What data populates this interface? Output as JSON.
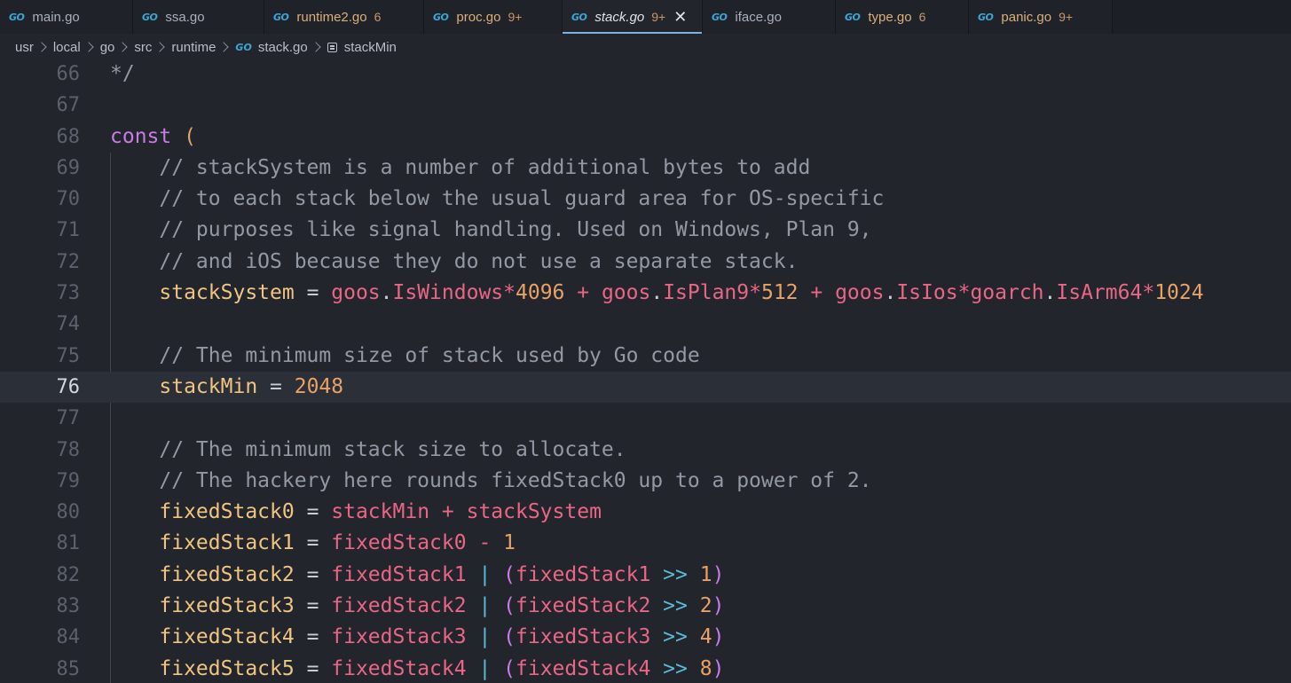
{
  "tabs": [
    {
      "label": "main.go",
      "badge": "",
      "modified": false,
      "active": false,
      "width": 150
    },
    {
      "label": "ssa.go",
      "badge": "",
      "modified": false,
      "active": false,
      "width": 148
    },
    {
      "label": "runtime2.go",
      "badge": "6",
      "modified": true,
      "active": false,
      "width": 180
    },
    {
      "label": "proc.go",
      "badge": "9+",
      "modified": true,
      "active": false,
      "width": 156
    },
    {
      "label": "stack.go",
      "badge": "9+",
      "modified": true,
      "active": true,
      "width": 158
    },
    {
      "label": "iface.go",
      "badge": "",
      "modified": false,
      "active": false,
      "width": 150
    },
    {
      "label": "type.go",
      "badge": "6",
      "modified": true,
      "active": false,
      "width": 150
    },
    {
      "label": "panic.go",
      "badge": "9+",
      "modified": true,
      "active": false,
      "width": 162
    }
  ],
  "tab_icon_text": "GO",
  "breadcrumb": [
    "usr",
    "local",
    "go",
    "src",
    "runtime",
    "stack.go",
    "stackMin"
  ],
  "current_line": 76,
  "code_lines": [
    {
      "n": 66,
      "t": [
        [
          "cmt",
          "*/"
        ]
      ]
    },
    {
      "n": 67,
      "t": []
    },
    {
      "n": 68,
      "t": [
        [
          "kw",
          "const"
        ],
        [
          "plain",
          " "
        ],
        [
          "paren",
          "("
        ]
      ]
    },
    {
      "n": 69,
      "t": [
        [
          "plain",
          "    "
        ],
        [
          "cmt",
          "// stackSystem is a number of additional bytes to add"
        ]
      ]
    },
    {
      "n": 70,
      "t": [
        [
          "plain",
          "    "
        ],
        [
          "cmt",
          "// to each stack below the usual guard area for OS-specific"
        ]
      ]
    },
    {
      "n": 71,
      "t": [
        [
          "plain",
          "    "
        ],
        [
          "cmt",
          "// purposes like signal handling. Used on Windows, Plan 9,"
        ]
      ]
    },
    {
      "n": 72,
      "t": [
        [
          "plain",
          "    "
        ],
        [
          "cmt",
          "// and iOS because they do not use a separate stack."
        ]
      ]
    },
    {
      "n": 73,
      "t": [
        [
          "plain",
          "    "
        ],
        [
          "const",
          "stackSystem"
        ],
        [
          "eq",
          " = "
        ],
        [
          "pkg",
          "goos"
        ],
        [
          "eq",
          "."
        ],
        [
          "pkg",
          "IsWindows"
        ],
        [
          "op",
          "*"
        ],
        [
          "num",
          "4096"
        ],
        [
          "op",
          " + "
        ],
        [
          "pkg",
          "goos"
        ],
        [
          "eq",
          "."
        ],
        [
          "pkg",
          "IsPlan9"
        ],
        [
          "op",
          "*"
        ],
        [
          "num",
          "512"
        ],
        [
          "op",
          " + "
        ],
        [
          "pkg",
          "goos"
        ],
        [
          "eq",
          "."
        ],
        [
          "pkg",
          "IsIos"
        ],
        [
          "op",
          "*"
        ],
        [
          "pkg",
          "goarch"
        ],
        [
          "eq",
          "."
        ],
        [
          "pkg",
          "IsArm64"
        ],
        [
          "op",
          "*"
        ],
        [
          "num",
          "1024"
        ]
      ]
    },
    {
      "n": 74,
      "t": []
    },
    {
      "n": 75,
      "t": [
        [
          "plain",
          "    "
        ],
        [
          "cmt",
          "// The minimum size of stack used by Go code"
        ]
      ]
    },
    {
      "n": 76,
      "t": [
        [
          "plain",
          "    "
        ],
        [
          "const",
          "stackMin"
        ],
        [
          "eq",
          " = "
        ],
        [
          "num",
          "2048"
        ]
      ]
    },
    {
      "n": 77,
      "t": []
    },
    {
      "n": 78,
      "t": [
        [
          "plain",
          "    "
        ],
        [
          "cmt",
          "// The minimum stack size to allocate."
        ]
      ]
    },
    {
      "n": 79,
      "t": [
        [
          "plain",
          "    "
        ],
        [
          "cmt",
          "// The hackery here rounds fixedStack0 up to a power of 2."
        ]
      ]
    },
    {
      "n": 80,
      "t": [
        [
          "plain",
          "    "
        ],
        [
          "const",
          "fixedStack0"
        ],
        [
          "eq",
          " = "
        ],
        [
          "pkg",
          "stackMin"
        ],
        [
          "op",
          " + "
        ],
        [
          "pkg",
          "stackSystem"
        ]
      ]
    },
    {
      "n": 81,
      "t": [
        [
          "plain",
          "    "
        ],
        [
          "const",
          "fixedStack1"
        ],
        [
          "eq",
          " = "
        ],
        [
          "pkg",
          "fixedStack0"
        ],
        [
          "op",
          " - "
        ],
        [
          "num",
          "1"
        ]
      ]
    },
    {
      "n": 82,
      "t": [
        [
          "plain",
          "    "
        ],
        [
          "const",
          "fixedStack2"
        ],
        [
          "eq",
          " = "
        ],
        [
          "pkg",
          "fixedStack1"
        ],
        [
          "pipe",
          " | "
        ],
        [
          "paren2",
          "("
        ],
        [
          "pkg",
          "fixedStack1"
        ],
        [
          "shift",
          " >> "
        ],
        [
          "num",
          "1"
        ],
        [
          "paren2",
          ")"
        ]
      ]
    },
    {
      "n": 83,
      "t": [
        [
          "plain",
          "    "
        ],
        [
          "const",
          "fixedStack3"
        ],
        [
          "eq",
          " = "
        ],
        [
          "pkg",
          "fixedStack2"
        ],
        [
          "pipe",
          " | "
        ],
        [
          "paren2",
          "("
        ],
        [
          "pkg",
          "fixedStack2"
        ],
        [
          "shift",
          " >> "
        ],
        [
          "num",
          "2"
        ],
        [
          "paren2",
          ")"
        ]
      ]
    },
    {
      "n": 84,
      "t": [
        [
          "plain",
          "    "
        ],
        [
          "const",
          "fixedStack4"
        ],
        [
          "eq",
          " = "
        ],
        [
          "pkg",
          "fixedStack3"
        ],
        [
          "pipe",
          " | "
        ],
        [
          "paren2",
          "("
        ],
        [
          "pkg",
          "fixedStack3"
        ],
        [
          "shift",
          " >> "
        ],
        [
          "num",
          "4"
        ],
        [
          "paren2",
          ")"
        ]
      ]
    },
    {
      "n": 85,
      "t": [
        [
          "plain",
          "    "
        ],
        [
          "const",
          "fixedStack5"
        ],
        [
          "eq",
          " = "
        ],
        [
          "pkg",
          "fixedStack4"
        ],
        [
          "pipe",
          " | "
        ],
        [
          "paren2",
          "("
        ],
        [
          "pkg",
          "fixedStack4"
        ],
        [
          "shift",
          " >> "
        ],
        [
          "num",
          "8"
        ],
        [
          "paren2",
          ")"
        ]
      ]
    }
  ]
}
